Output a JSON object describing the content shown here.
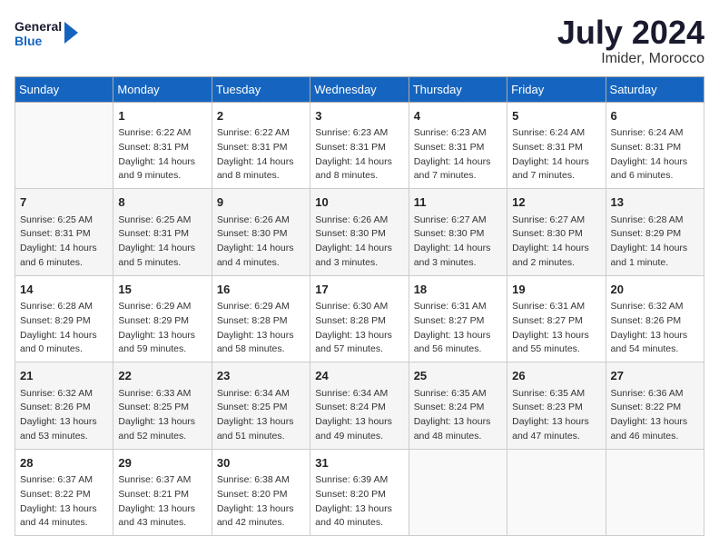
{
  "header": {
    "logo_line1": "General",
    "logo_line2": "Blue",
    "month_year": "July 2024",
    "location": "Imider, Morocco"
  },
  "days_of_week": [
    "Sunday",
    "Monday",
    "Tuesday",
    "Wednesday",
    "Thursday",
    "Friday",
    "Saturday"
  ],
  "weeks": [
    [
      {
        "day": "",
        "info": ""
      },
      {
        "day": "1",
        "info": "Sunrise: 6:22 AM\nSunset: 8:31 PM\nDaylight: 14 hours\nand 9 minutes."
      },
      {
        "day": "2",
        "info": "Sunrise: 6:22 AM\nSunset: 8:31 PM\nDaylight: 14 hours\nand 8 minutes."
      },
      {
        "day": "3",
        "info": "Sunrise: 6:23 AM\nSunset: 8:31 PM\nDaylight: 14 hours\nand 8 minutes."
      },
      {
        "day": "4",
        "info": "Sunrise: 6:23 AM\nSunset: 8:31 PM\nDaylight: 14 hours\nand 7 minutes."
      },
      {
        "day": "5",
        "info": "Sunrise: 6:24 AM\nSunset: 8:31 PM\nDaylight: 14 hours\nand 7 minutes."
      },
      {
        "day": "6",
        "info": "Sunrise: 6:24 AM\nSunset: 8:31 PM\nDaylight: 14 hours\nand 6 minutes."
      }
    ],
    [
      {
        "day": "7",
        "info": "Sunrise: 6:25 AM\nSunset: 8:31 PM\nDaylight: 14 hours\nand 6 minutes."
      },
      {
        "day": "8",
        "info": "Sunrise: 6:25 AM\nSunset: 8:31 PM\nDaylight: 14 hours\nand 5 minutes."
      },
      {
        "day": "9",
        "info": "Sunrise: 6:26 AM\nSunset: 8:30 PM\nDaylight: 14 hours\nand 4 minutes."
      },
      {
        "day": "10",
        "info": "Sunrise: 6:26 AM\nSunset: 8:30 PM\nDaylight: 14 hours\nand 3 minutes."
      },
      {
        "day": "11",
        "info": "Sunrise: 6:27 AM\nSunset: 8:30 PM\nDaylight: 14 hours\nand 3 minutes."
      },
      {
        "day": "12",
        "info": "Sunrise: 6:27 AM\nSunset: 8:30 PM\nDaylight: 14 hours\nand 2 minutes."
      },
      {
        "day": "13",
        "info": "Sunrise: 6:28 AM\nSunset: 8:29 PM\nDaylight: 14 hours\nand 1 minute."
      }
    ],
    [
      {
        "day": "14",
        "info": "Sunrise: 6:28 AM\nSunset: 8:29 PM\nDaylight: 14 hours\nand 0 minutes."
      },
      {
        "day": "15",
        "info": "Sunrise: 6:29 AM\nSunset: 8:29 PM\nDaylight: 13 hours\nand 59 minutes."
      },
      {
        "day": "16",
        "info": "Sunrise: 6:29 AM\nSunset: 8:28 PM\nDaylight: 13 hours\nand 58 minutes."
      },
      {
        "day": "17",
        "info": "Sunrise: 6:30 AM\nSunset: 8:28 PM\nDaylight: 13 hours\nand 57 minutes."
      },
      {
        "day": "18",
        "info": "Sunrise: 6:31 AM\nSunset: 8:27 PM\nDaylight: 13 hours\nand 56 minutes."
      },
      {
        "day": "19",
        "info": "Sunrise: 6:31 AM\nSunset: 8:27 PM\nDaylight: 13 hours\nand 55 minutes."
      },
      {
        "day": "20",
        "info": "Sunrise: 6:32 AM\nSunset: 8:26 PM\nDaylight: 13 hours\nand 54 minutes."
      }
    ],
    [
      {
        "day": "21",
        "info": "Sunrise: 6:32 AM\nSunset: 8:26 PM\nDaylight: 13 hours\nand 53 minutes."
      },
      {
        "day": "22",
        "info": "Sunrise: 6:33 AM\nSunset: 8:25 PM\nDaylight: 13 hours\nand 52 minutes."
      },
      {
        "day": "23",
        "info": "Sunrise: 6:34 AM\nSunset: 8:25 PM\nDaylight: 13 hours\nand 51 minutes."
      },
      {
        "day": "24",
        "info": "Sunrise: 6:34 AM\nSunset: 8:24 PM\nDaylight: 13 hours\nand 49 minutes."
      },
      {
        "day": "25",
        "info": "Sunrise: 6:35 AM\nSunset: 8:24 PM\nDaylight: 13 hours\nand 48 minutes."
      },
      {
        "day": "26",
        "info": "Sunrise: 6:35 AM\nSunset: 8:23 PM\nDaylight: 13 hours\nand 47 minutes."
      },
      {
        "day": "27",
        "info": "Sunrise: 6:36 AM\nSunset: 8:22 PM\nDaylight: 13 hours\nand 46 minutes."
      }
    ],
    [
      {
        "day": "28",
        "info": "Sunrise: 6:37 AM\nSunset: 8:22 PM\nDaylight: 13 hours\nand 44 minutes."
      },
      {
        "day": "29",
        "info": "Sunrise: 6:37 AM\nSunset: 8:21 PM\nDaylight: 13 hours\nand 43 minutes."
      },
      {
        "day": "30",
        "info": "Sunrise: 6:38 AM\nSunset: 8:20 PM\nDaylight: 13 hours\nand 42 minutes."
      },
      {
        "day": "31",
        "info": "Sunrise: 6:39 AM\nSunset: 8:20 PM\nDaylight: 13 hours\nand 40 minutes."
      },
      {
        "day": "",
        "info": ""
      },
      {
        "day": "",
        "info": ""
      },
      {
        "day": "",
        "info": ""
      }
    ]
  ]
}
